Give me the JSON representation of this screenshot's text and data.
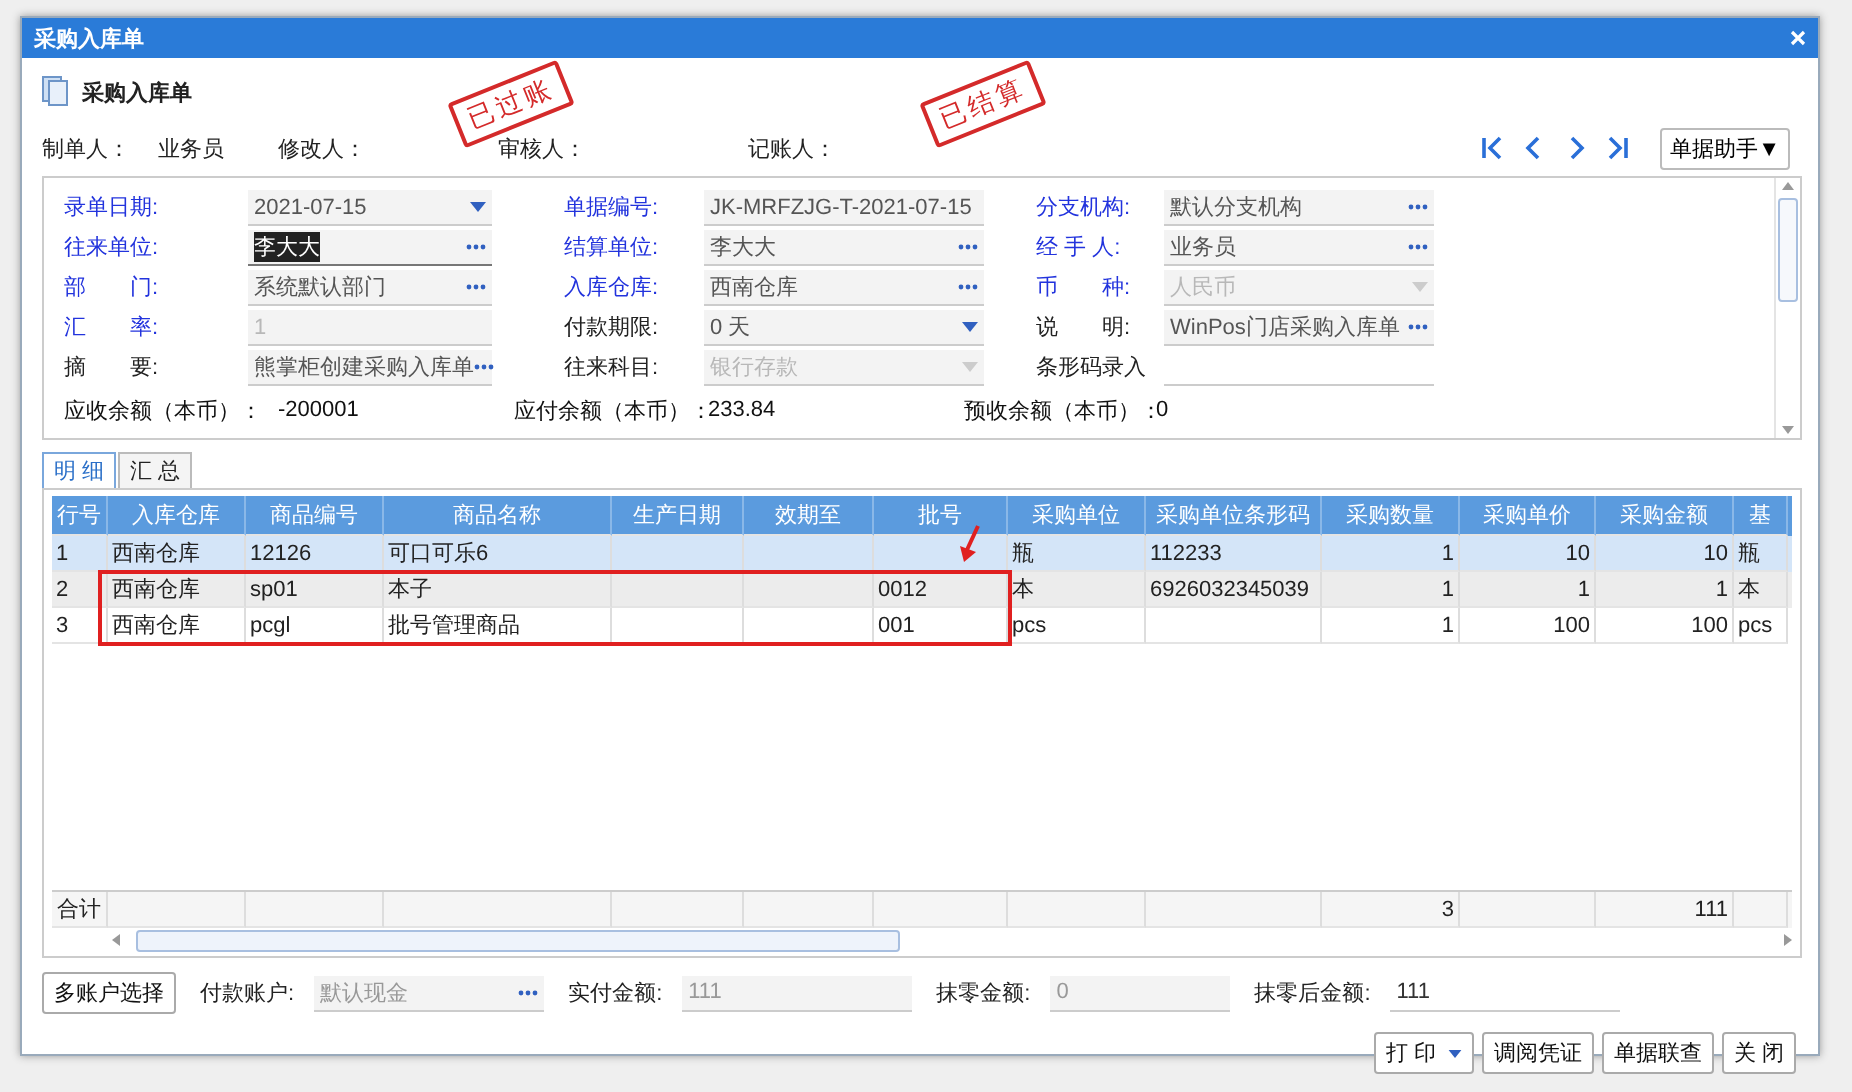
{
  "window": {
    "title": "采购入库单"
  },
  "header": {
    "title": "采购入库单",
    "people": [
      {
        "label": "制单人：",
        "value": "业务员"
      },
      {
        "label": "修改人："
      },
      {
        "label": "审核人："
      },
      {
        "label": "记账人："
      }
    ],
    "helper_button": "单据助手▼"
  },
  "stamps": [
    {
      "text": "已过账"
    },
    {
      "text": "已结算"
    }
  ],
  "form": {
    "fields": [
      {
        "label": "录单日期:",
        "required": true,
        "value": "2021-07-15",
        "kind": "dropdown",
        "disabled": false,
        "highlighted": false
      },
      {
        "label": "单据编号:",
        "required": true,
        "value": "JK-MRFZJG-T-2021-07-15",
        "kind": "plain",
        "disabled": false,
        "highlighted": false
      },
      {
        "label": "分支机构:",
        "required": true,
        "value": "默认分支机构",
        "kind": "lookup",
        "disabled": false,
        "highlighted": false
      },
      {
        "label": "往来单位:",
        "required": true,
        "value": "李大大",
        "kind": "lookup",
        "disabled": false,
        "highlighted": true
      },
      {
        "label": "结算单位:",
        "required": true,
        "value": "李大大",
        "kind": "lookup",
        "disabled": false,
        "highlighted": false
      },
      {
        "label": "经 手 人:",
        "required": true,
        "value": "业务员",
        "kind": "lookup",
        "disabled": false,
        "highlighted": false
      },
      {
        "label": "部　　门:",
        "required": true,
        "value": "系统默认部门",
        "kind": "lookup",
        "disabled": false,
        "highlighted": false
      },
      {
        "label": "入库仓库:",
        "required": true,
        "value": "西南仓库",
        "kind": "lookup",
        "disabled": false,
        "highlighted": false
      },
      {
        "label": "币　　种:",
        "required": true,
        "value": "人民币",
        "kind": "dropdown",
        "disabled": true,
        "highlighted": false
      },
      {
        "label": "汇　　率:",
        "required": true,
        "value": "1",
        "kind": "plain",
        "disabled": true,
        "highlighted": false
      },
      {
        "label": "付款期限:",
        "required": false,
        "value": "0 天",
        "kind": "dropdown",
        "disabled": false,
        "highlighted": false
      },
      {
        "label": "说　　明:",
        "required": false,
        "value": "WinPos门店采购入库单",
        "kind": "lookup",
        "disabled": false,
        "highlighted": false
      },
      {
        "label": "摘　　要:",
        "required": false,
        "value": "熊掌柜创建采购入库单",
        "kind": "lookup",
        "disabled": false,
        "highlighted": false
      },
      {
        "label": "往来科目:",
        "required": false,
        "value": "银行存款",
        "kind": "dropdown",
        "disabled": true,
        "highlighted": false
      },
      {
        "label": "条形码录入",
        "required": false,
        "kind": "line",
        "disabled": false,
        "highlighted": false
      }
    ],
    "balances": [
      {
        "label": "应收余额（本币）：",
        "value": "-200001"
      },
      {
        "label": "应付余额（本币）：",
        "value": "233.84"
      },
      {
        "label": "预收余额（本币）：",
        "value": "0"
      }
    ]
  },
  "tabs": [
    {
      "label": "明 细",
      "selected": true
    },
    {
      "label": "汇 总",
      "selected": false
    }
  ],
  "table": {
    "columns": [
      "行号",
      "入库仓库",
      "商品编号",
      "商品名称",
      "生产日期",
      "效期至",
      "批号",
      "采购单位",
      "采购单位条形码",
      "采购数量",
      "采购单价",
      "采购金额",
      "基"
    ],
    "rows": [
      {
        "selected": true,
        "cells": [
          "1",
          "西南仓库",
          "12126",
          "可口可乐6",
          null,
          null,
          null,
          "瓶",
          "112233",
          "1",
          "10",
          "10",
          "瓶"
        ]
      },
      {
        "selected": false,
        "cells": [
          "2",
          "西南仓库",
          "sp01",
          "本子",
          null,
          null,
          "0012",
          "本",
          "6926032345039",
          "1",
          "1",
          "1",
          "本"
        ]
      },
      {
        "selected": false,
        "cells": [
          "3",
          "西南仓库",
          "pcgl",
          "批号管理商品",
          null,
          null,
          "001",
          "pcs",
          null,
          "1",
          "100",
          "100",
          "pcs"
        ]
      }
    ],
    "totals": {
      "label": "合计",
      "quantity": "3",
      "amount": "111"
    }
  },
  "payment": {
    "multi_account_button": "多账户选择",
    "fields": [
      {
        "label": "付款账户:",
        "value": "默认现金",
        "kind": "lookup",
        "disabled": true
      },
      {
        "label": "实付金额:",
        "value": "111",
        "kind": "plain",
        "disabled": true
      },
      {
        "label": "抹零金额:",
        "value": "0",
        "kind": "plain",
        "disabled": true
      },
      {
        "label": "抹零后金额:",
        "value": "111",
        "kind": "line",
        "disabled": false
      }
    ]
  },
  "buttons": [
    {
      "label": "打 印",
      "kind": "menu"
    },
    {
      "label": "调阅凭证",
      "kind": "plain"
    },
    {
      "label": "单据联查",
      "kind": "plain"
    },
    {
      "label": "关 闭",
      "kind": "plain"
    }
  ]
}
